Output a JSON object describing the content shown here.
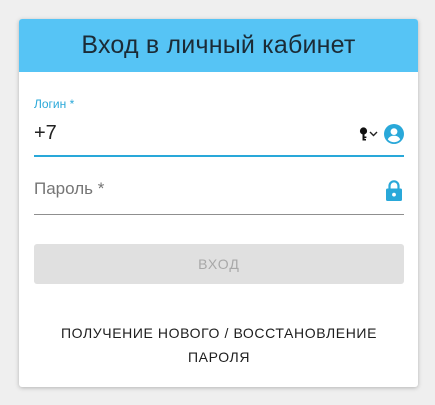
{
  "header": {
    "title": "Вход в личный кабинет",
    "background": "#56c4f5"
  },
  "login_field": {
    "label": "Логин *",
    "value": "+7",
    "accent": "#29a8d9",
    "icons": [
      "key-icon",
      "chevron-down-icon",
      "account-circle-icon"
    ]
  },
  "password_field": {
    "label": "Пароль *",
    "icons": [
      "lock-icon"
    ]
  },
  "submit": {
    "label": "ВХОД",
    "state": "disabled"
  },
  "recover": {
    "line1": "ПОЛУЧЕНИЕ НОВОГО / ВОССТАНОВЛЕНИЕ",
    "line2": "ПАРОЛЯ"
  }
}
